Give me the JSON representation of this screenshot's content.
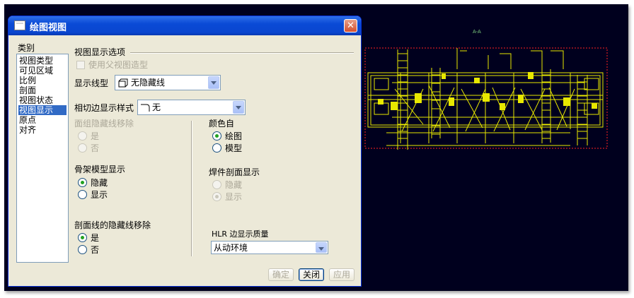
{
  "dialog": {
    "title": "绘图视图",
    "close_glyph": "✕",
    "category_label": "类别",
    "categories": [
      "视图类型",
      "可见区域",
      "比例",
      "剖面",
      "视图状态",
      "视图显示",
      "原点",
      "对齐"
    ],
    "selected_category": "视图显示",
    "section_title": "视图显示选项",
    "use_parent_label": "使用父视图造型",
    "display_style_label": "显示线型",
    "display_style_value": "无隐藏线",
    "tangent_label": "相切边显示样式",
    "tangent_value": "无",
    "face_hidden_label": "面组隐藏线移除",
    "face_hidden_options": [
      "是",
      "否"
    ],
    "color_from_label": "颜色自",
    "color_from_options": [
      "绘图",
      "模型"
    ],
    "color_from_selected": "绘图",
    "skeleton_label": "骨架模型显示",
    "skeleton_options": [
      "隐藏",
      "显示"
    ],
    "skeleton_selected": "隐藏",
    "weld_label": "焊件剖面显示",
    "weld_options": [
      "隐藏",
      "显示"
    ],
    "weld_selected": "显示",
    "section_hidden_label": "剖面线的隐藏线移除",
    "section_hidden_options": [
      "是",
      "否"
    ],
    "section_hidden_selected": "是",
    "hlr_label": "HLR 边显示质量",
    "hlr_value": "从动环境",
    "buttons": {
      "ok": "确定",
      "close": "关闭",
      "apply": "应用"
    }
  },
  "canvas": {
    "annotation": "A-A",
    "background_color": "#00001e",
    "drawing_color": "#e8e800",
    "frame_color": "#ff2020"
  }
}
